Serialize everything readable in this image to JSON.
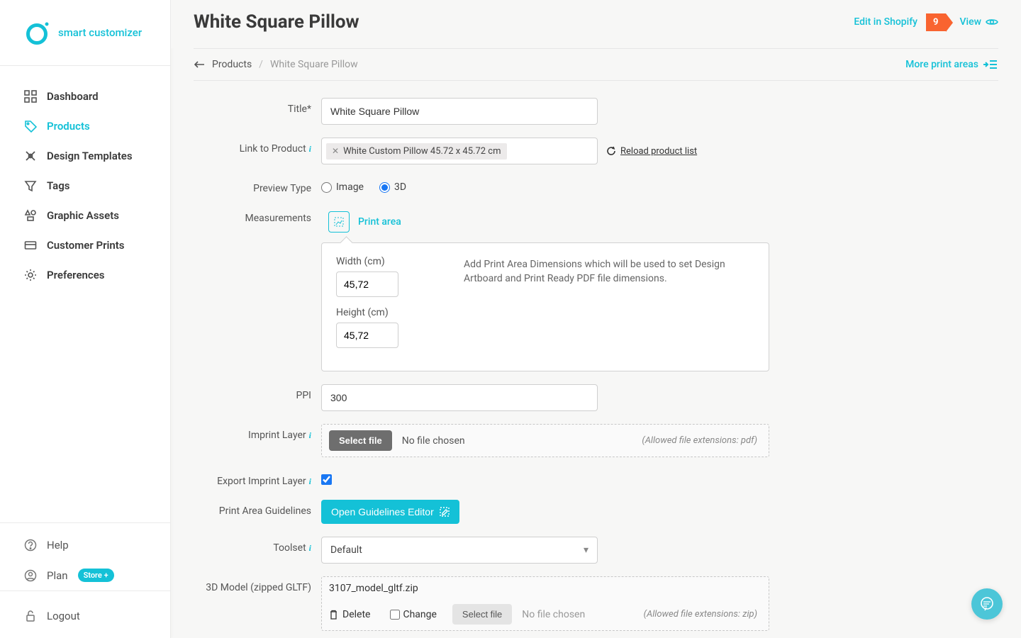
{
  "brand": "smart customizer",
  "sidebar": {
    "items": [
      {
        "label": "Dashboard"
      },
      {
        "label": "Products"
      },
      {
        "label": "Design Templates"
      },
      {
        "label": "Tags"
      },
      {
        "label": "Graphic Assets"
      },
      {
        "label": "Customer Prints"
      },
      {
        "label": "Preferences"
      }
    ],
    "help": "Help",
    "plan_label": "Plan",
    "plan_pill": "Store +",
    "logout": "Logout"
  },
  "header": {
    "title": "White Square Pillow",
    "edit_shopify": "Edit in Shopify",
    "badge": "9",
    "view": "View"
  },
  "breadcrumb": {
    "root": "Products",
    "current": "White Square Pillow",
    "more": "More print areas"
  },
  "form": {
    "title_label": "Title*",
    "title_value": "White Square Pillow",
    "link_label": "Link to Product",
    "link_chip": "White Custom Pillow 45.72 x 45.72 cm",
    "reload": "Reload product list",
    "preview_label": "Preview Type",
    "preview_image": "Image",
    "preview_3d": "3D",
    "measurements_label": "Measurements",
    "printarea_tab": "Print area",
    "width_label": "Width (cm)",
    "width_value": "45,72",
    "height_label": "Height (cm)",
    "height_value": "45,72",
    "panel_desc": "Add Print Area Dimensions which will be used to set Design Artboard and Print Ready PDF file dimensions.",
    "ppi_label": "PPI",
    "ppi_value": "300",
    "imprint_label": "Imprint Layer",
    "select_file": "Select file",
    "no_file": "No file chosen",
    "imprint_hint": "(Allowed file extensions: pdf)",
    "export_label": "Export Imprint Layer",
    "guidelines_label": "Print Area Guidelines",
    "guidelines_btn": "Open Guidelines Editor",
    "toolset_label": "Toolset",
    "toolset_value": "Default",
    "model_label": "3D Model (zipped GLTF)",
    "model_file": "3107_model_gltf.zip",
    "delete_btn": "Delete",
    "change_label": "Change",
    "model_hint": "(Allowed file extensions: zip)"
  }
}
